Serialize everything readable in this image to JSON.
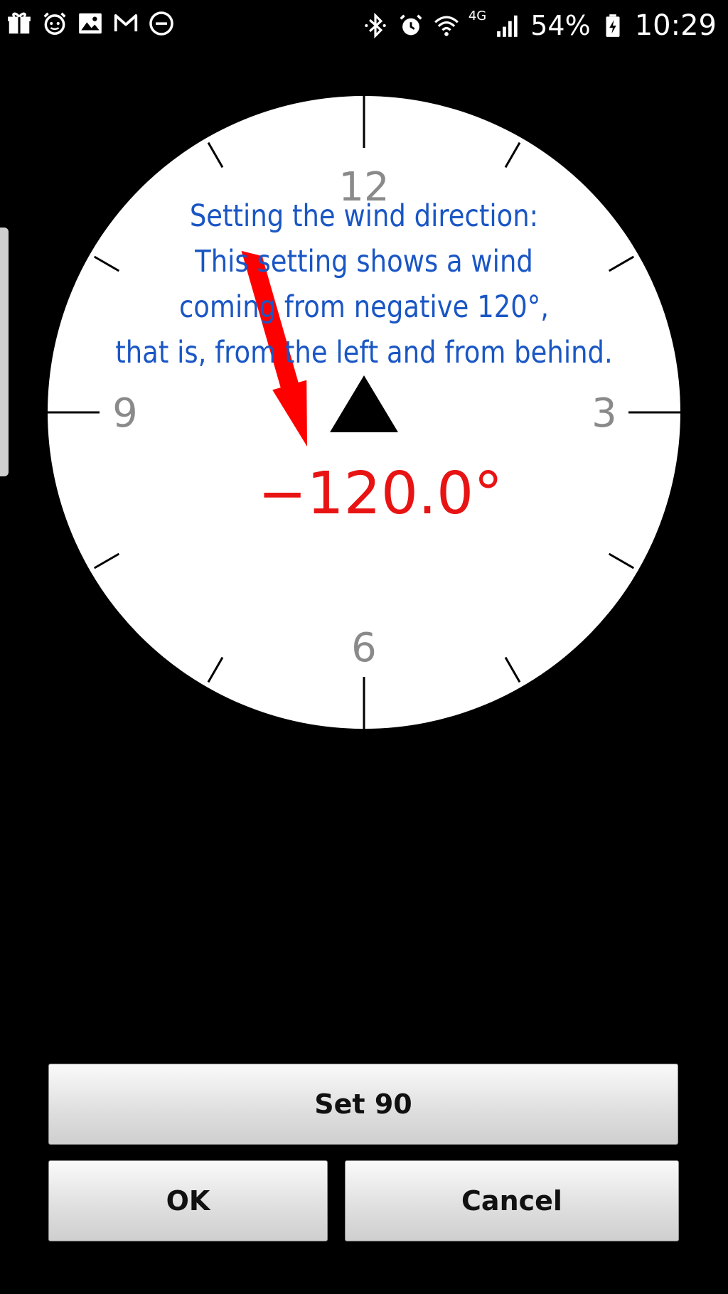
{
  "status_bar": {
    "battery": "54%",
    "time": "10:29",
    "network": "4G",
    "left_icons": [
      "gift-icon",
      "alarm-face-icon",
      "image-icon",
      "gmail-icon",
      "do-not-disturb-icon"
    ],
    "right_icons": [
      "bluetooth-icon",
      "alarm-icon",
      "wifi-icon",
      "signal-icon",
      "battery-icon"
    ]
  },
  "dial": {
    "hour_labels": {
      "top": "12",
      "right": "3",
      "bottom": "6",
      "left": "9"
    },
    "instruction_lines": [
      "Setting the wind direction:",
      "This setting shows a wind",
      "coming from negative 120°,",
      "that is, from the left and from behind."
    ],
    "wind_angle_value": -120.0,
    "wind_angle_label": "−120.0°",
    "colors": {
      "dial_face": "#ffffff",
      "instruction_text": "#1a56c4",
      "wind_arrow": "#ff0000",
      "angle_text": "#e81313",
      "hour_labels": "#8a8a8a",
      "heading_marker": "#000000"
    }
  },
  "buttons": {
    "set": "Set 90",
    "ok": "OK",
    "cancel": "Cancel"
  }
}
